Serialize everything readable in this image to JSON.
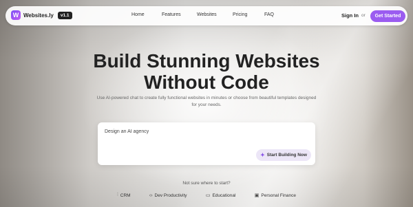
{
  "brand": {
    "name": "Websites.ly",
    "version": "v1.1",
    "mark": "W"
  },
  "nav": {
    "links": [
      "Home",
      "Features",
      "Websites",
      "Pricing",
      "FAQ"
    ],
    "signin": "Sign In",
    "or": "or",
    "cta": "Get Started"
  },
  "hero": {
    "title_line1": "Build Stunning Websites",
    "title_line2": "Without Code",
    "subtitle": "Use AI-powered chat to create fully functional websites in minutes or choose from beautiful templates designed for your needs."
  },
  "prompt": {
    "value": "Design an AI agency",
    "button": "Start Building Now"
  },
  "suggestions": {
    "hint": "Not sure where to start?",
    "chips": [
      {
        "label": "CRM",
        "icon": "chart-icon"
      },
      {
        "label": "Dev Productivity",
        "icon": "code-icon"
      },
      {
        "label": "Educational",
        "icon": "book-icon"
      },
      {
        "label": "Personal Finance",
        "icon": "wallet-icon"
      }
    ]
  },
  "colors": {
    "accent": "#9b5cf0",
    "accent_soft": "#ece6f7",
    "dark": "#222222"
  }
}
